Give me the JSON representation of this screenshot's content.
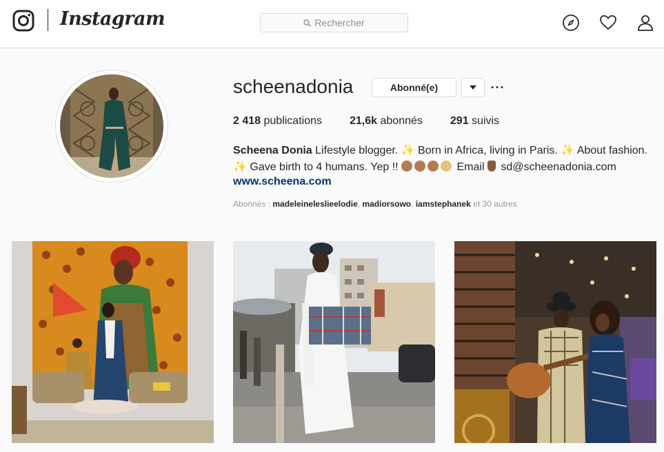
{
  "app": {
    "brand": "Instagram"
  },
  "search": {
    "placeholder": "Rechercher"
  },
  "nav": {
    "icons": [
      "explore-compass-icon",
      "activity-heart-icon",
      "profile-person-icon"
    ]
  },
  "profile": {
    "username": "scheenadonia",
    "follow_label": "Abonné(e)",
    "stats": [
      {
        "value": "2 418",
        "label": "publications"
      },
      {
        "value": "21,6k",
        "label": "abonnés"
      },
      {
        "value": "291",
        "label": "suivis"
      }
    ],
    "bio": {
      "full_name": "Scheena Donia",
      "line1": " Lifestyle blogger. ",
      "line1b": " Born in Africa, living in Paris. ",
      "line1c": " About fashion.",
      "line2a": " Gave birth to 4 humans. Yep !! ",
      "line2b": " Email ",
      "line2c": " sd@scheenadonia.com",
      "sparkle": "✨"
    },
    "website": "www.scheena.com",
    "followed_by": {
      "prefix": "Abonnés : ",
      "users": [
        "madeleineleslieelodie",
        "madiorsowo",
        "iamstephanek"
      ],
      "sep": ", ",
      "suffix": " et 30 autres"
    }
  },
  "colors": {
    "link": "#003569",
    "border": "#dbdbdb",
    "muted": "#999999",
    "text": "#262626"
  }
}
